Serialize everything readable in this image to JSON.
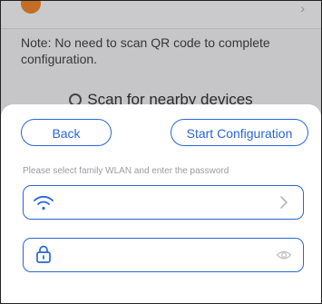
{
  "background": {
    "list_row": {
      "label": "",
      "chevron": "›"
    },
    "note": "Note: No need to scan QR code to complete configuration.",
    "scan_label": "Scan for nearby devices"
  },
  "sheet": {
    "back_label": "Back",
    "start_label": "Start Configuration",
    "hint": "Please select family WLAN and enter the password",
    "wifi_field": {
      "value": "",
      "placeholder": "",
      "lead_icon": "wifi-icon",
      "trail_icon": "chevron-right-icon"
    },
    "password_field": {
      "value": "",
      "placeholder": "",
      "lead_icon": "lock-icon",
      "trail_icon": "eye-icon"
    }
  },
  "colors": {
    "accent": "#2a66d6",
    "hint_text": "#9b9ba0",
    "row_icon": "#f0862f"
  }
}
